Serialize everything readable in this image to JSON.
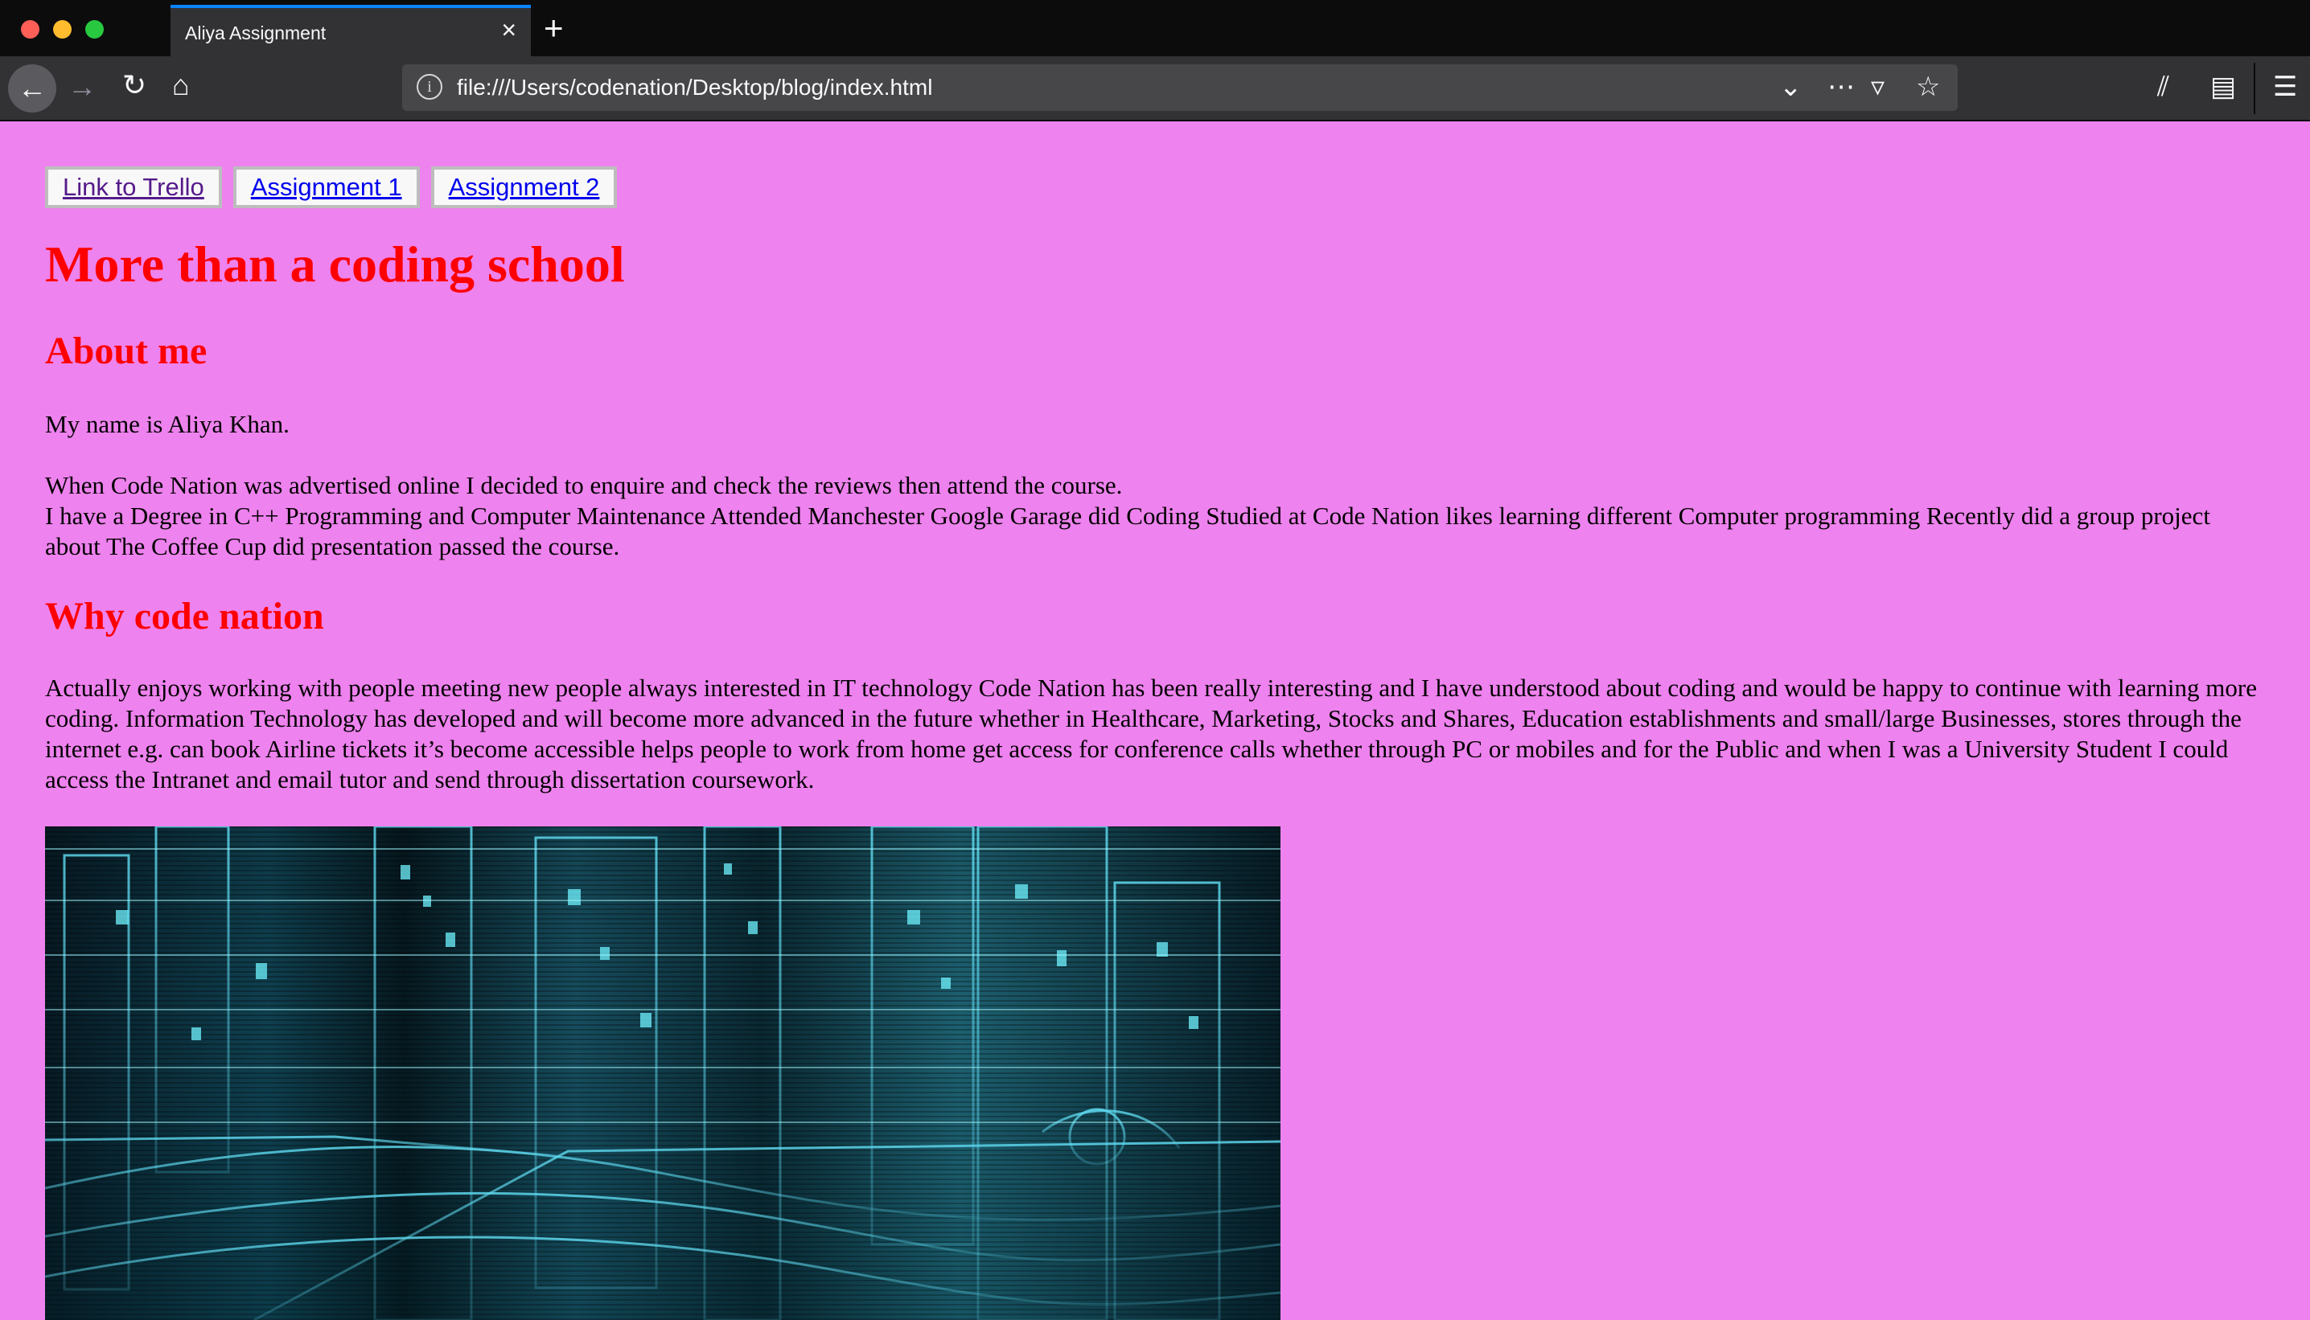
{
  "browser": {
    "tab_title": "Aliya Assignment",
    "url": "file:///Users/codenation/Desktop/blog/index.html"
  },
  "page": {
    "buttons": [
      {
        "label": "Link to Trello"
      },
      {
        "label": "Assignment 1"
      },
      {
        "label": "Assignment 2"
      }
    ],
    "title": "More than a coding school",
    "about_heading": "About me",
    "about_name": "My name is Aliya Khan.",
    "about_intro": "When Code Nation was advertised online I decided to enquire and check the reviews then attend the course.",
    "about_degree": "I have a Degree in C++ Programming and Computer Maintenance Attended Manchester Google Garage did Coding Studied at Code Nation likes learning different Computer programming Recently did a group project about The Coffee Cup did presentation passed the course.",
    "why_heading": "Why code nation",
    "why_paragraph": "Actually enjoys working with people meeting new people always interested in IT technology Code Nation has been really interesting and I have understood about coding and would be happy to continue with learning more coding. Information Technology has developed and will become more advanced in the future whether in Healthcare, Marketing, Stocks and Shares, Education establishments and small/large Businesses, stores through the internet e.g. can book Airline tickets it’s become accessible helps people to work from home get access for conference calls whether through PC or mobiles and for the Public and when I was a University Student I could access the Intranet and email tutor and send through dissertation coursework."
  },
  "colors": {
    "page_background": "#ee82ee",
    "heading": "#ff0000",
    "link": "#0000ee",
    "visited_link": "#551a8b",
    "image_glow": "#66e8ff"
  },
  "icons": [
    "close-icon",
    "plus-icon",
    "back-arrow-icon",
    "forward-arrow-icon",
    "reload-icon",
    "home-icon",
    "info-icon",
    "chevron-down-icon",
    "more-icon",
    "pocket-icon",
    "star-icon",
    "library-icon",
    "sidebar-icon",
    "hamburger-menu-icon"
  ]
}
